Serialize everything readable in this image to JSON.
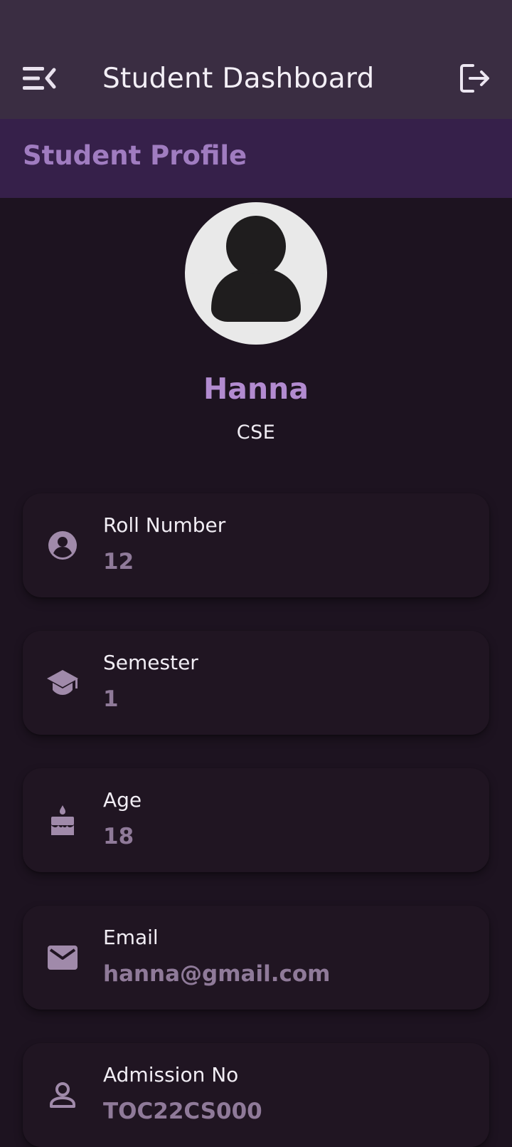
{
  "app_bar": {
    "title": "Student Dashboard",
    "menu_icon": "menu-open-icon",
    "logout_icon": "logout-icon",
    "background": "#3a2d42"
  },
  "section": {
    "title": "Student Profile",
    "background": "#36204a",
    "title_color": "#a07cc0"
  },
  "profile": {
    "avatar_icon": "person-avatar-icon",
    "name": "Hanna",
    "department": "CSE",
    "name_color": "#b28bd0"
  },
  "cards": [
    {
      "icon": "account-circle-icon",
      "label": "Roll Number",
      "value": "12"
    },
    {
      "icon": "school-icon",
      "label": "Semester",
      "value": "1"
    },
    {
      "icon": "cake-icon",
      "label": "Age",
      "value": "18"
    },
    {
      "icon": "email-icon",
      "label": "Email",
      "value": "hanna@gmail.com"
    },
    {
      "icon": "person-outline-icon",
      "label": "Admission No",
      "value": "TOC22CS000"
    }
  ],
  "colors": {
    "page_background": "#1d1320",
    "card_background": "#201522",
    "icon_color": "#a08aaa",
    "value_color": "#8f7a99"
  }
}
